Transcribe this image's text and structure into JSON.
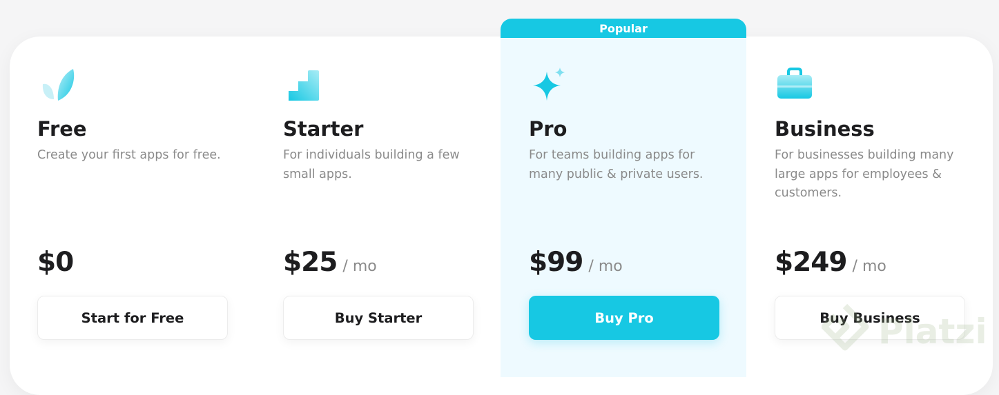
{
  "popular_label": "Popular",
  "accent_color": "#17c8e3",
  "plans": [
    {
      "icon": "leaf-icon",
      "name": "Free",
      "description": "Create your first apps for free.",
      "price": "$0",
      "period": "",
      "button": "Start for Free"
    },
    {
      "icon": "stairs-icon",
      "name": "Starter",
      "description": "For individuals building a few small apps.",
      "price": "$25",
      "period": "/ mo",
      "button": "Buy Starter"
    },
    {
      "icon": "sparkle-icon",
      "name": "Pro",
      "description": "For teams building apps for many public & private users.",
      "price": "$99",
      "period": "/ mo",
      "button": "Buy Pro"
    },
    {
      "icon": "briefcase-icon",
      "name": "Business",
      "description": "For businesses building many large apps for employees & customers.",
      "price": "$249",
      "period": "/ mo",
      "button": "Buy Business"
    }
  ],
  "watermark": "Platzi"
}
